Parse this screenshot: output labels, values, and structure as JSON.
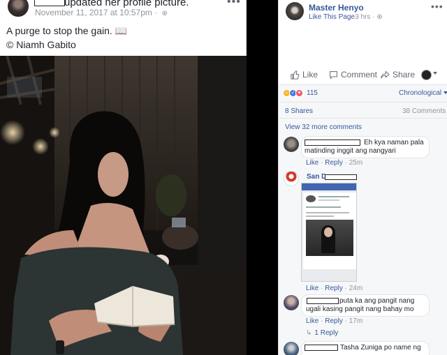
{
  "post": {
    "updated_text": "updated her profile picture.",
    "date": "November 11, 2017 at 10:57pm",
    "date_separator": "·",
    "globe_glyph": "⊕",
    "menu_glyph": "•••",
    "caption_line1": "A purge to stop the gain. 📖",
    "caption_line2": "© Niamh Gabito"
  },
  "page": {
    "name": "Master Henyo",
    "like_page": "Like This Page",
    "time": "· 3 hrs · ⊕",
    "menu_glyph": "•••"
  },
  "actions": {
    "like": "Like",
    "comment": "Comment",
    "share": "Share"
  },
  "reactions": {
    "count": "115",
    "sort": "Chronological",
    "icons": [
      "haha-icon",
      "like-icon",
      "love-icon"
    ]
  },
  "stats": {
    "shares": "8 Shares",
    "comments": "38 Comments"
  },
  "view_more": "View 32 more comments",
  "comments": [
    {
      "text_line1": "Eh kya naman pala",
      "text_line2": "matinding inggit ang nangyari",
      "like": "Like",
      "reply": "Reply",
      "time": "25m"
    },
    {
      "name": "San D",
      "like": "Like",
      "reply": "Reply",
      "time": "24m"
    },
    {
      "text_line1": "puta ka ang pangit nang",
      "text_line2": "ugali kasing pangit nang bahay mo",
      "like": "Like",
      "reply": "Reply",
      "time": "17m",
      "replies": "1 Reply"
    },
    {
      "text_line1": "Tasha Zuniga po name ng"
    }
  ],
  "colors": {
    "link": "#365899",
    "meta": "#90949c",
    "facebook_blue": "#4267b2"
  }
}
